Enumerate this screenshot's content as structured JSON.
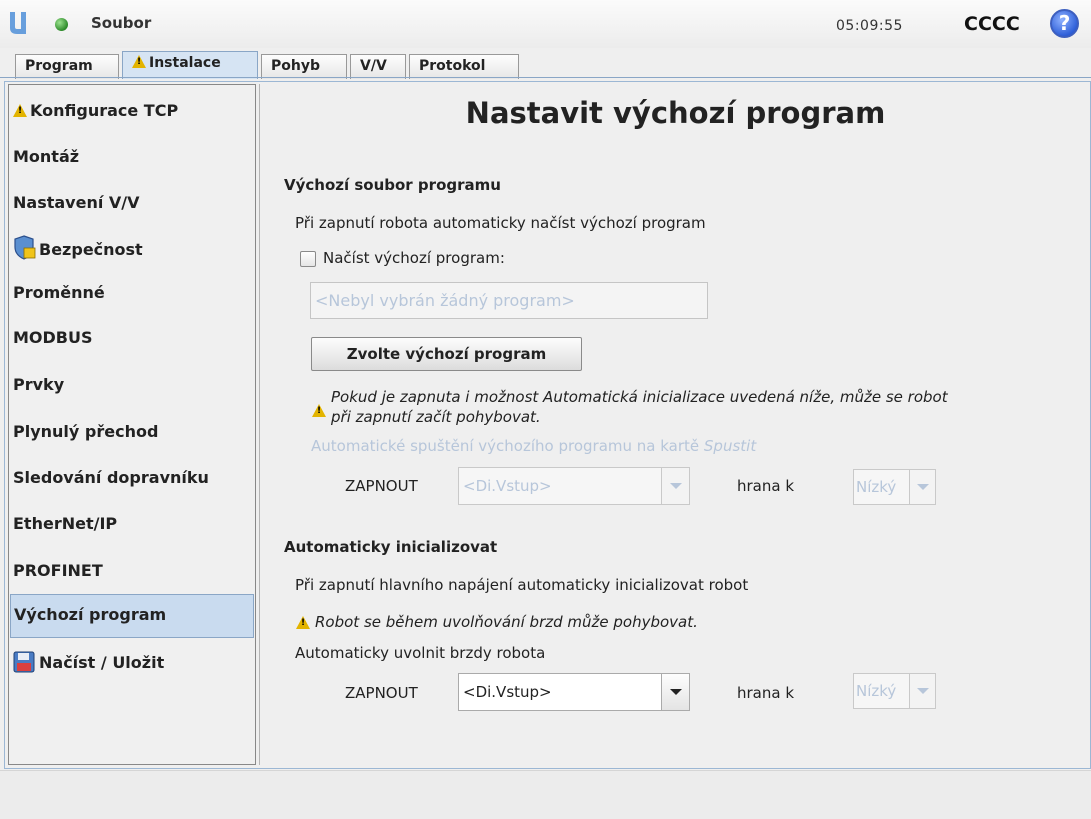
{
  "header": {
    "file_label": "Soubor",
    "clock": "05:09:55",
    "robot_name": "CCCC",
    "help_glyph": "?"
  },
  "tabs": [
    {
      "label": "Program",
      "active": false
    },
    {
      "label": "Instalace",
      "active": true,
      "warning": true
    },
    {
      "label": "Pohyb",
      "active": false
    },
    {
      "label": "V/V",
      "active": false
    },
    {
      "label": "Protokol",
      "active": false
    }
  ],
  "sidebar": {
    "items": [
      {
        "label": "Konfigurace TCP",
        "icon": "warning-icon"
      },
      {
        "label": "Montáž"
      },
      {
        "label": "Nastavení V/V"
      },
      {
        "label": "Bezpečnost",
        "icon": "shield-icon"
      },
      {
        "label": "Proměnné"
      },
      {
        "label": "MODBUS"
      },
      {
        "label": "Prvky"
      },
      {
        "label": "Plynulý přechod"
      },
      {
        "label": "Sledování dopravníku"
      },
      {
        "label": "EtherNet/IP"
      },
      {
        "label": "PROFINET"
      },
      {
        "label": "Výchozí program",
        "selected": true
      },
      {
        "label": "Načíst / Uložit",
        "icon": "floppy-disk-icon"
      }
    ]
  },
  "main": {
    "title": "Nastavit výchozí program",
    "default_section": {
      "heading": "Výchozí soubor programu",
      "description": "Při zapnutí robota automaticky načíst výchozí program",
      "checkbox_label": "Načíst výchozí program:",
      "checkbox_checked": false,
      "program_field_placeholder": "<Nebyl vybrán žádný program>",
      "choose_button": "Zvolte výchozí program",
      "warning_line1": "Pokud je zapnuta i možnost Automatická inicializace uvedená níže, může se robot",
      "warning_line2": "při zapnutí začít pohybovat.",
      "autostart_prefix": "Automatické spuštění výchozího programu na kartě ",
      "autostart_tab_name": "Spustit",
      "enable_label": "ZAPNOUT",
      "input_value": "<Di.Vstup>",
      "edge_label": "hrana k",
      "edge_value": "Nízký"
    },
    "init_section": {
      "heading": "Automaticky inicializovat",
      "description": "Při zapnutí hlavního napájení automaticky inicializovat robot",
      "warning": "Robot se během uvolňování brzd může pohybovat.",
      "brakes_label": "Automaticky uvolnit brzdy robota",
      "enable_label": "ZAPNOUT",
      "input_value": "<Di.Vstup>",
      "edge_label": "hrana k",
      "edge_value": "Nízký"
    }
  },
  "colors": {
    "selected_bg": "#c9dbef",
    "disabled_text": "#b7c6da",
    "warning_yellow": "#e3b400"
  }
}
